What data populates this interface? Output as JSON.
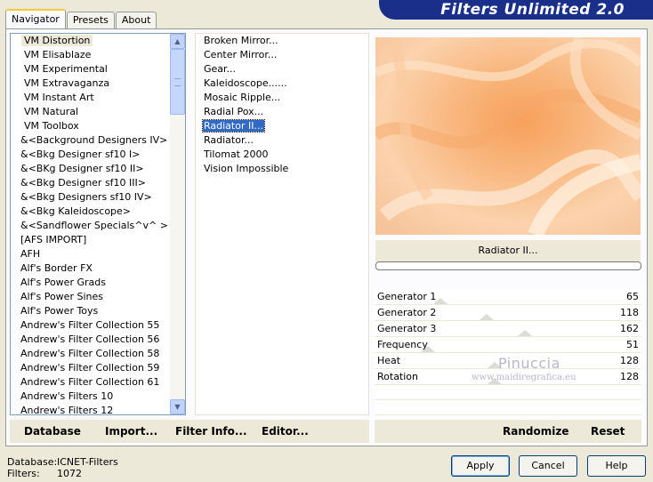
{
  "tabs": [
    {
      "label": "Navigator",
      "active": true
    },
    {
      "label": "Presets",
      "active": false
    },
    {
      "label": "About",
      "active": false
    }
  ],
  "banner_title": "Filters Unlimited 2.0",
  "categories": {
    "selected_index": 0,
    "items": [
      "VM Distortion",
      "VM Elisablaze",
      "VM Experimental",
      "VM Extravaganza",
      "VM Instant Art",
      "VM Natural",
      "VM Toolbox",
      "&<Background Designers IV>",
      "&<Bkg Designer sf10 I>",
      "&<BKg Designer sf10 II>",
      "&<Bkg Designer sf10 III>",
      "&<Bkg Designers sf10 IV>",
      "&<Bkg Kaleidoscope>",
      "&<Sandflower Specials^v^ >",
      "[AFS IMPORT]",
      "AFH",
      "Alf's Border FX",
      "Alf's Power Grads",
      "Alf's Power Sines",
      "Alf's Power Toys",
      "Andrew's Filter Collection 55",
      "Andrew's Filter Collection 56",
      "Andrew's Filter Collection 58",
      "Andrew's Filter Collection 59",
      "Andrew's Filter Collection 61",
      "Andrew's Filters 10",
      "Andrew's Filters 12"
    ]
  },
  "filters": {
    "selected_index": 6,
    "items": [
      "Broken Mirror...",
      "Center Mirror...",
      "Gear...",
      "Kaleidoscope......",
      "Mosaic Ripple...",
      "Radial Pox...",
      "Radiator II...",
      "Radiator...",
      "Tilomat 2000",
      "Vision Impossible"
    ]
  },
  "preview": {
    "filter_name": "Radiator II..."
  },
  "progress_fraction": 0.0,
  "parameters": [
    {
      "label": "Generator 1",
      "value": "65"
    },
    {
      "label": "Generator 2",
      "value": "118"
    },
    {
      "label": "Generator 3",
      "value": "162"
    },
    {
      "label": "Frequency",
      "value": "51"
    },
    {
      "label": "Heat",
      "value": "128"
    },
    {
      "label": "Rotation",
      "value": "128"
    }
  ],
  "watermark": {
    "line1": "Pinuccia",
    "line2": "www.maidiregrafica.eu"
  },
  "left_buttons": {
    "database": "Database",
    "import": "Import...",
    "filter_info": "Filter Info...",
    "editor": "Editor..."
  },
  "right_buttons": {
    "randomize": "Randomize",
    "reset": "Reset"
  },
  "status": {
    "database_label": "Database:",
    "database_value": "ICNET-Filters",
    "filters_label": "Filters:",
    "filters_value": "1072"
  },
  "dialog_buttons": {
    "apply": "Apply",
    "cancel": "Cancel",
    "help": "Help"
  },
  "colors": {
    "selection": "#316ac5",
    "banner": "#1a2f8a",
    "face": "#ece9d8"
  }
}
